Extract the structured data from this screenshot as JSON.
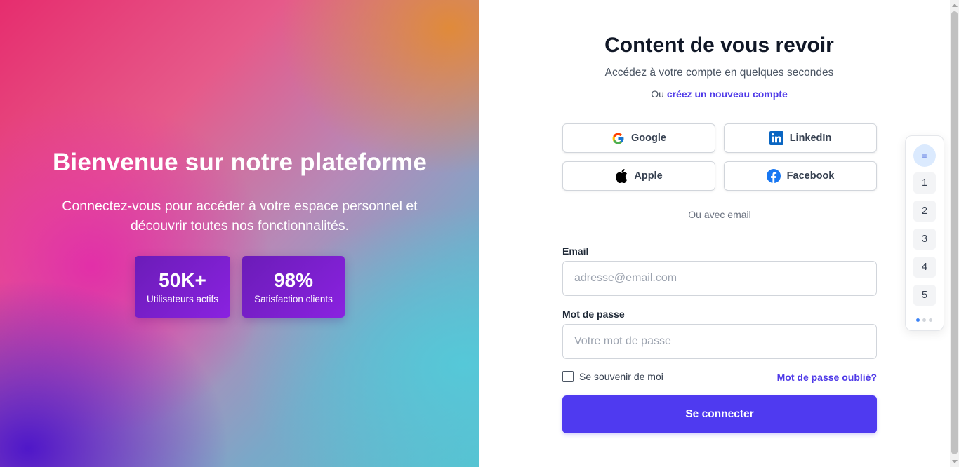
{
  "hero": {
    "title": "Bienvenue sur notre plateforme",
    "subtitle": "Connectez-vous pour accéder à votre espace personnel et découvrir toutes nos fonctionnalités.",
    "stats": [
      {
        "value": "50K+",
        "label": "Utilisateurs actifs"
      },
      {
        "value": "98%",
        "label": "Satisfaction clients"
      }
    ]
  },
  "login": {
    "title": "Content de vous revoir",
    "subtitle": "Accédez à votre compte en quelques secondes",
    "signup_prefix": "Ou",
    "signup_link": "créez un nouveau compte",
    "social": {
      "google": "Google",
      "linkedin": "LinkedIn",
      "apple": "Apple",
      "facebook": "Facebook"
    },
    "divider": "Ou avec email",
    "email_label": "Email",
    "email_placeholder": "adresse@email.com",
    "password_label": "Mot de passe",
    "password_placeholder": "Votre mot de passe",
    "remember": "Se souvenir de moi",
    "forgot": "Mot de passe oublié?",
    "submit": "Se connecter"
  },
  "navigator": {
    "menu_icon": "≡",
    "items": [
      "1",
      "2",
      "3",
      "4",
      "5"
    ]
  },
  "colors": {
    "accent": "#4f3af0",
    "link": "#4f3ae8",
    "stat_card": "#7a1fd0",
    "nav_active_dot": "#3b82f6"
  },
  "icons": [
    "google-icon",
    "linkedin-icon",
    "apple-icon",
    "facebook-icon",
    "menu-icon"
  ]
}
